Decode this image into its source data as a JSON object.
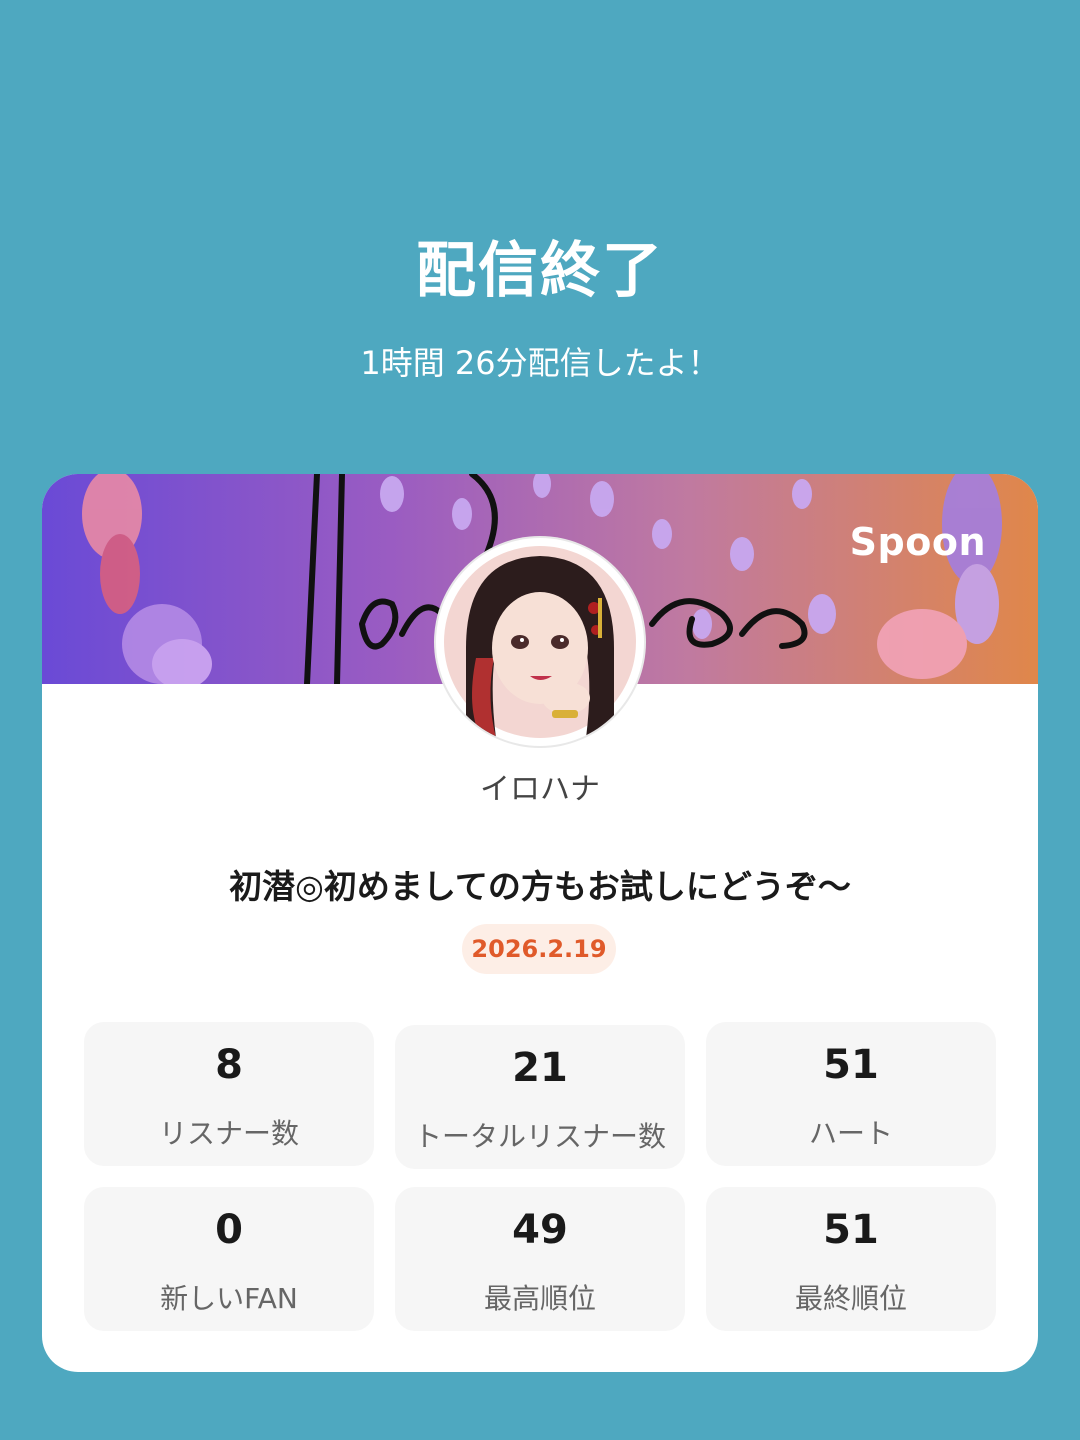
{
  "header": {
    "title": "配信終了",
    "subtitle": "1時間 26分配信したよ！"
  },
  "card": {
    "banner_text": "Irohana",
    "brand_logo": "Spoon",
    "username": "イロハナ",
    "live_title": "初潜◎初めましての方もお試しにどうぞ～",
    "date": "2026.2.19",
    "stats": [
      {
        "value": "8",
        "label": "リスナー数"
      },
      {
        "value": "21",
        "label": "トータルリスナー数"
      },
      {
        "value": "51",
        "label": "ハート"
      },
      {
        "value": "0",
        "label": "新しいFAN"
      },
      {
        "value": "49",
        "label": "最高順位"
      },
      {
        "value": "51",
        "label": "最終順位"
      }
    ]
  },
  "colors": {
    "background": "#4ea8c0",
    "date_accent": "#e05a2a",
    "date_badge_bg": "#fdeee6"
  }
}
